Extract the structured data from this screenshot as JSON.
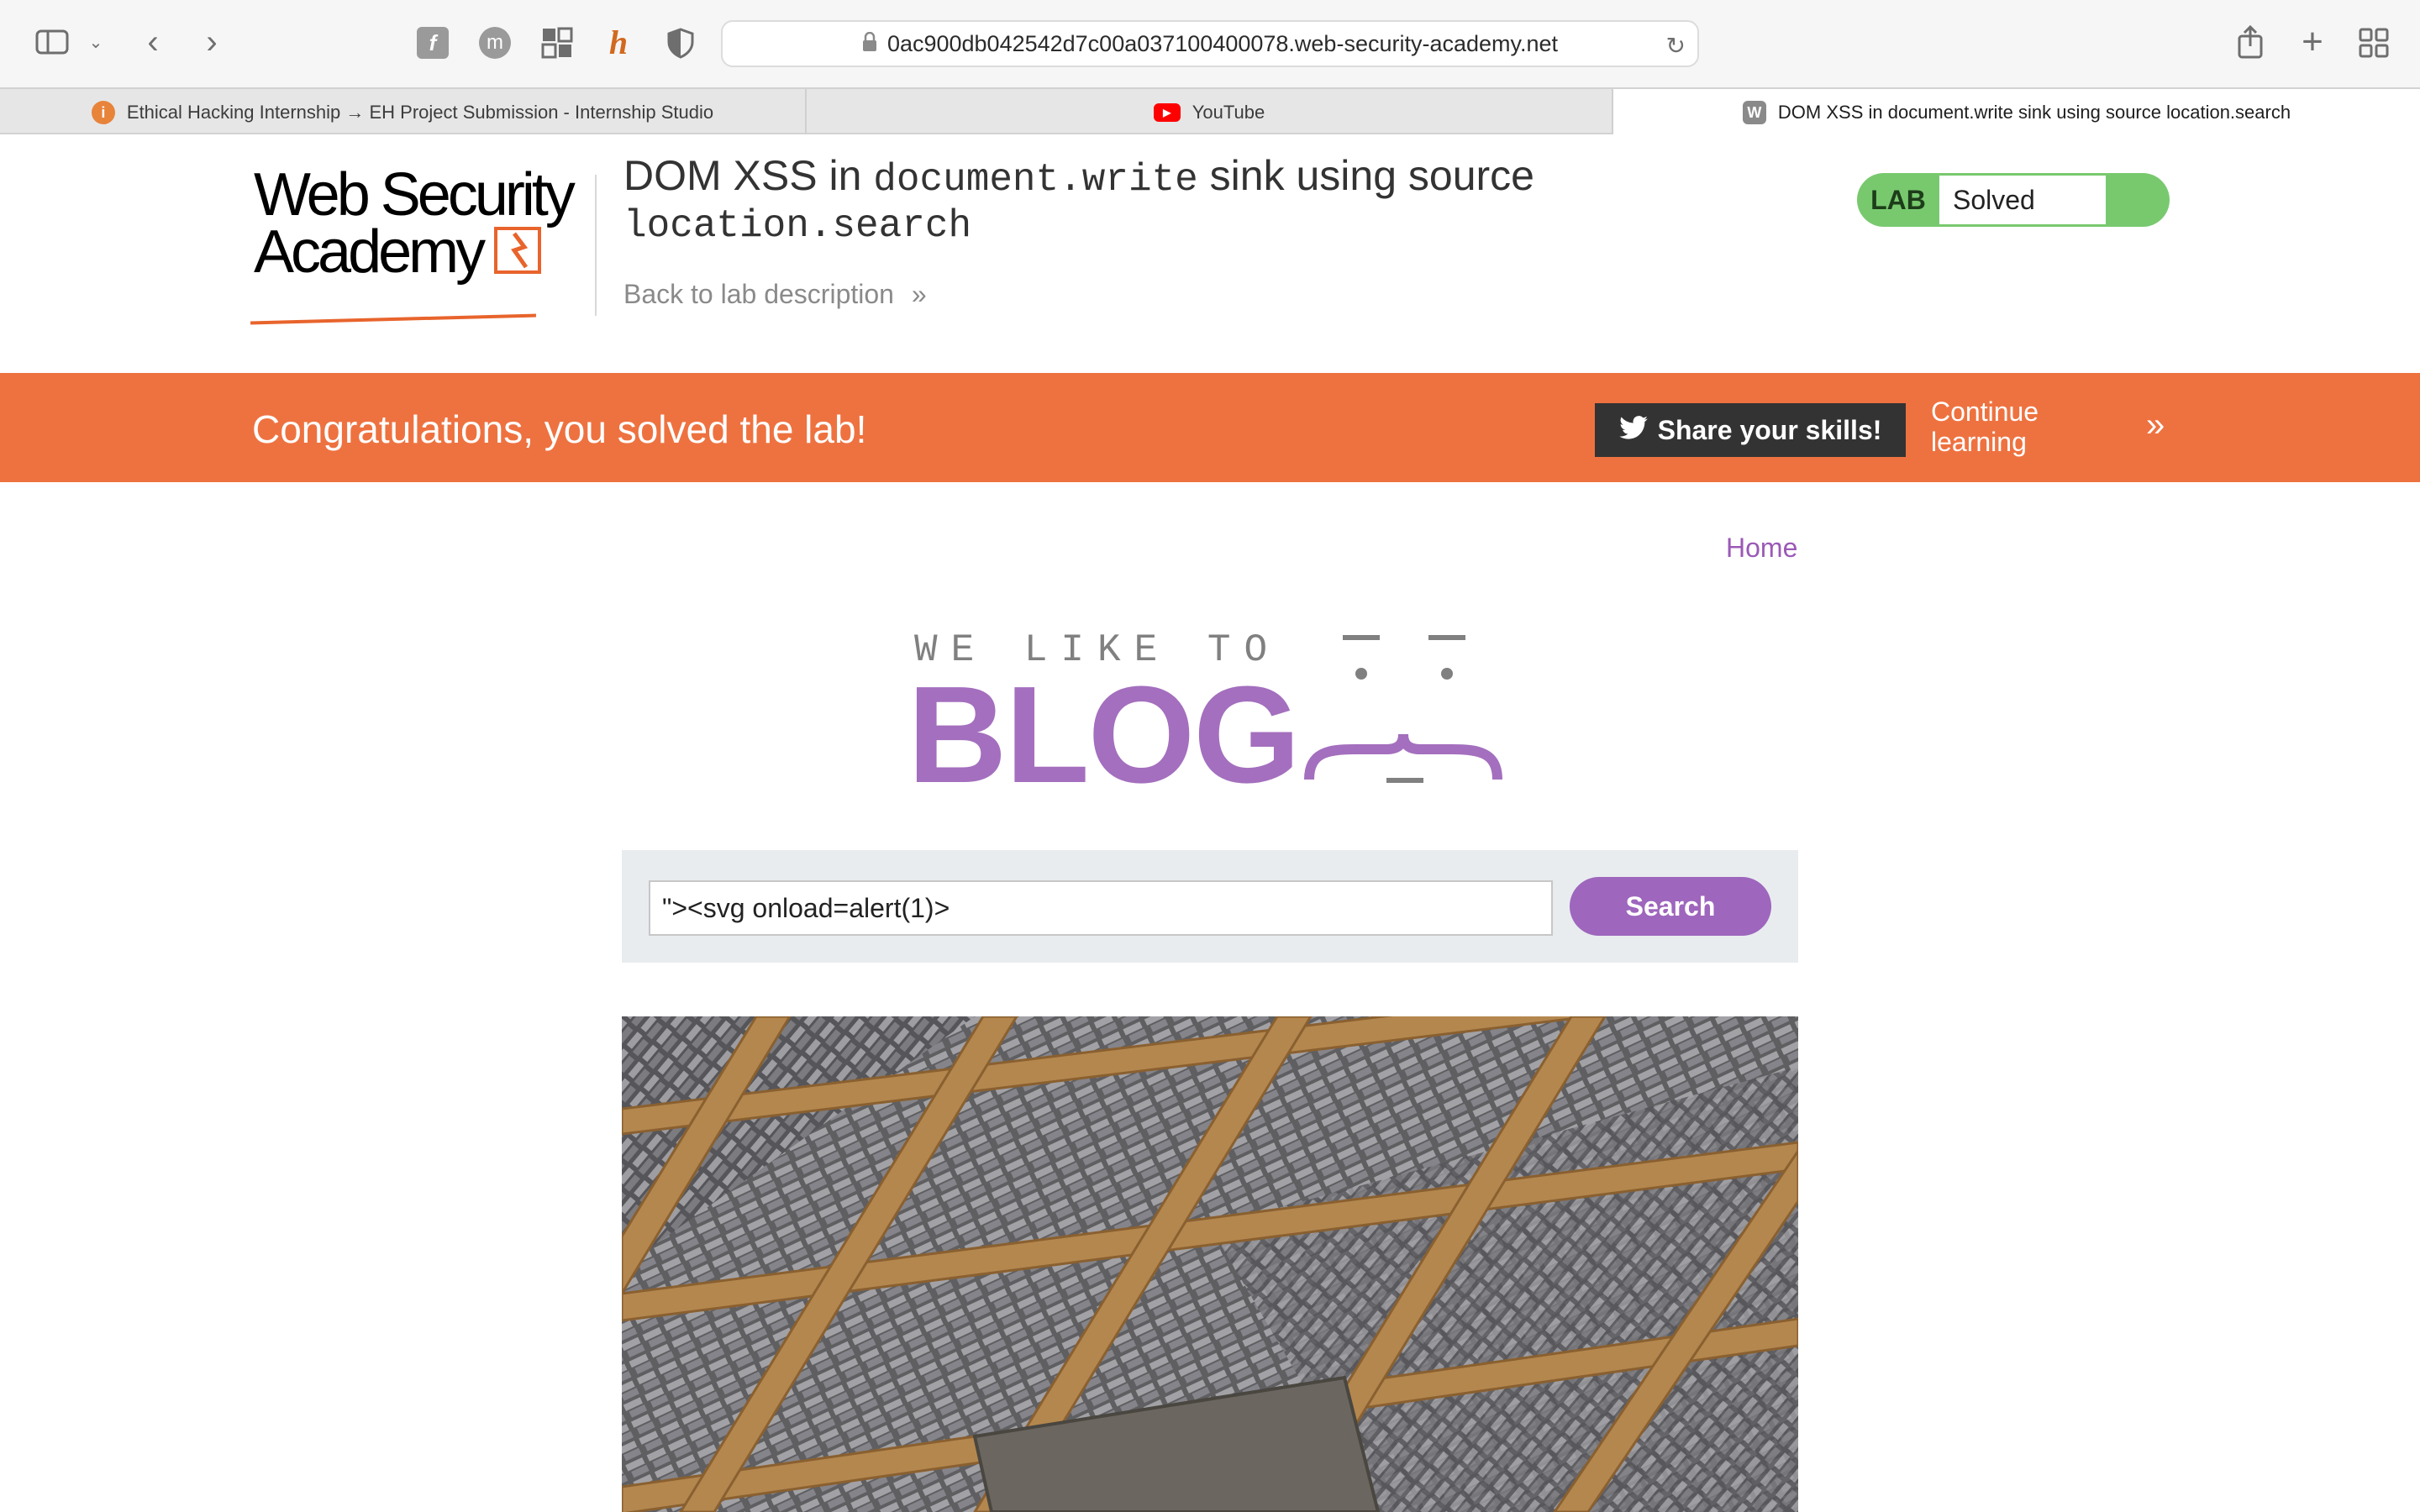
{
  "browser": {
    "url": "0ac900db042542d7c00a037100400078.web-security-academy.net",
    "tabs": [
      {
        "label": "Ethical Hacking Internship → EH Project Submission - Internship Studio",
        "icon": "internship-studio-icon",
        "color": "#e8833a"
      },
      {
        "label": "YouTube",
        "icon": "youtube-icon",
        "color": "#ff0000"
      },
      {
        "label": "DOM XSS in document.write sink using source location.search",
        "icon": "web-security-academy-icon",
        "color": "#8a8a8a"
      }
    ],
    "tab_favicon_w": "W"
  },
  "lab": {
    "logo_line1": "Web Security",
    "logo_line2": "Academy",
    "title_prefix": "DOM XSS in ",
    "title_code1": "document.write",
    "title_middle": " sink using source",
    "title_code2": "location.search",
    "back_link": "Back to lab description",
    "status_label": "LAB",
    "status_value": "Solved",
    "status_color": "#78c96e"
  },
  "banner": {
    "message": "Congratulations, you solved the lab!",
    "share": "Share your skills!",
    "continue": "Continue learning",
    "color": "#ee7240"
  },
  "blog": {
    "home": "Home",
    "tagline": "WE LIKE TO",
    "word": "BLOG",
    "search_value": "\"><svg onload=alert(1)>",
    "search_button": "Search",
    "accent": "#9e66bd"
  }
}
